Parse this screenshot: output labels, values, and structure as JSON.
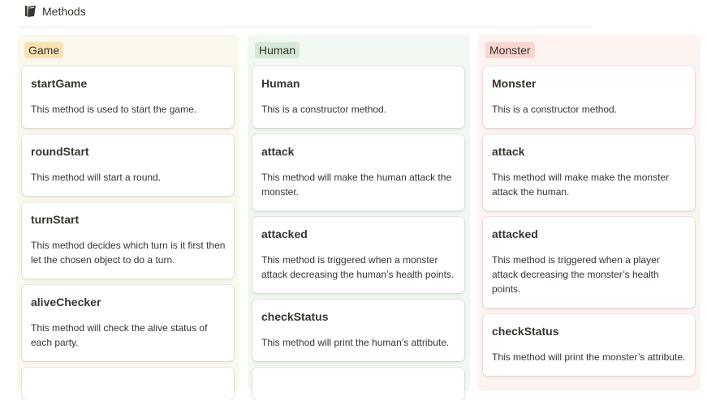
{
  "page": {
    "title": "Methods",
    "icon": "book-icon"
  },
  "columns": [
    {
      "label": "Game",
      "color": "#fae3b3",
      "cards": [
        {
          "title": "startGame",
          "desc": "This method is used to start the game."
        },
        {
          "title": "roundStart",
          "desc": "This method will start a round."
        },
        {
          "title": "turnStart",
          "desc": "This method decides which turn is it first then let the chosen object to do a turn."
        },
        {
          "title": "aliveChecker",
          "desc": "This method will check the alive status of each party."
        },
        {
          "title": "",
          "desc": ""
        }
      ]
    },
    {
      "label": "Human",
      "color": "#d5e9d6",
      "cards": [
        {
          "title": "Human",
          "desc": "This is a constructor method."
        },
        {
          "title": "attack",
          "desc": "This method will make the human attack the monster."
        },
        {
          "title": "attacked",
          "desc": "This method is triggered when a monster attack decreasing the human’s health points."
        },
        {
          "title": "checkStatus",
          "desc": "This method will print the human’s attribute."
        },
        {
          "title": "",
          "desc": ""
        }
      ]
    },
    {
      "label": "Monster",
      "color": "#fad6d1",
      "cards": [
        {
          "title": "Monster",
          "desc": "This is a constructor method."
        },
        {
          "title": "attack",
          "desc": "This method will make make the monster attack the human."
        },
        {
          "title": "attacked",
          "desc": "This method is triggered when a player attack decreasing the monster’s health points."
        },
        {
          "title": "checkStatus",
          "desc": "This method will print the monster’s attribute."
        }
      ]
    }
  ]
}
